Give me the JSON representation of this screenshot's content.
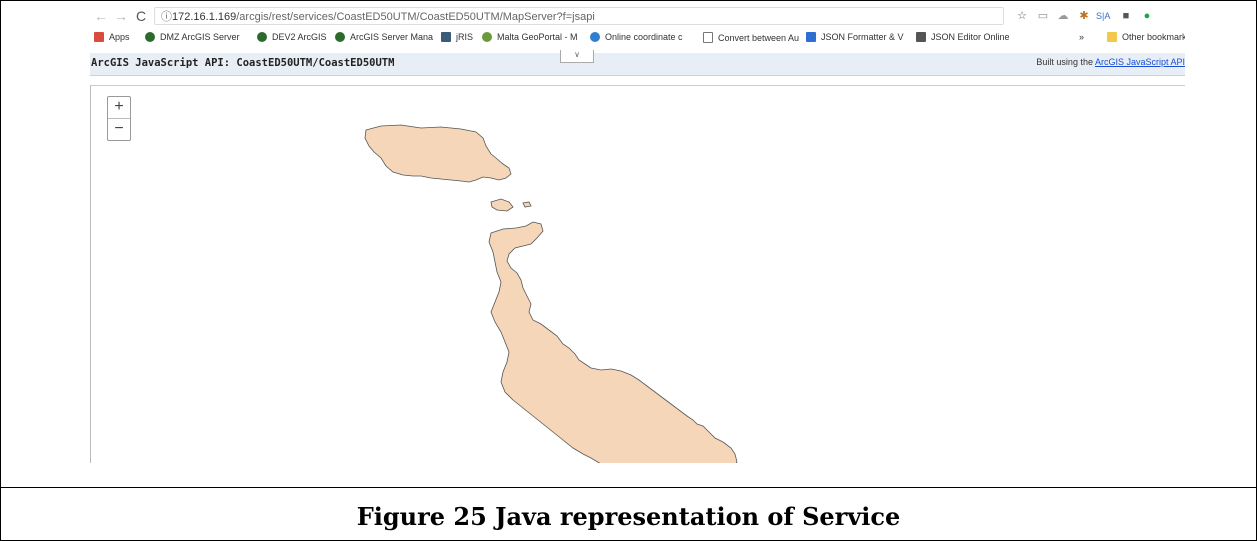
{
  "browser": {
    "address_host": "172.16.1.169",
    "address_path": "/arcgis/rest/services/CoastED50UTM/CoastED50UTM/MapServer?f=jsapi",
    "bookmarks": [
      {
        "label": "Apps",
        "color": "#d94b3a"
      },
      {
        "label": "DMZ ArcGIS Server",
        "color": "#2d6a2d"
      },
      {
        "label": "DEV2 ArcGIS",
        "color": "#2d6a2d"
      },
      {
        "label": "ArcGIS Server Mana",
        "color": "#2d6a2d"
      },
      {
        "label": "jRIS",
        "color": "#3b5b7a"
      },
      {
        "label": "Malta GeoPortal - M",
        "color": "#6b9a3a"
      },
      {
        "label": "Online coordinate c",
        "color": "#2f7fd1"
      },
      {
        "label": "Convert between Au",
        "color": "#777777"
      },
      {
        "label": "JSON Formatter & V",
        "color": "#2f6fd1"
      },
      {
        "label": "JSON Editor Online",
        "color": "#555555"
      }
    ],
    "overflow": "»",
    "other_bookmarks": "Other bookmark"
  },
  "api_bar": {
    "title": "ArcGIS JavaScript API: CoastED50UTM/CoastED50UTM",
    "built_prefix": "Built using the ",
    "built_link": "ArcGIS JavaScript API"
  },
  "map": {
    "zoom_in": "+",
    "zoom_out": "−",
    "land_color": "#f5d6b8",
    "outline_color": "#555555"
  },
  "caption": "Figure 25 Java representation of Service"
}
